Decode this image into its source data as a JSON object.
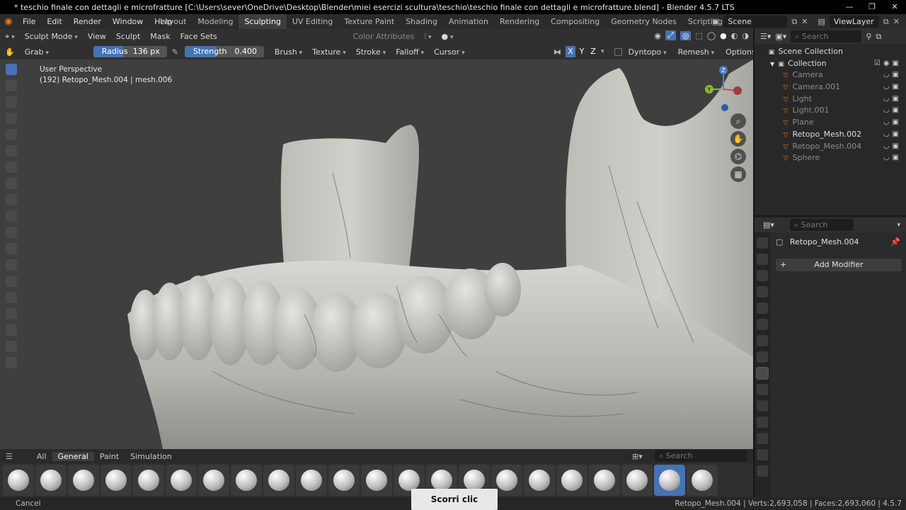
{
  "window": {
    "title": "* teschio finale con dettagli e microfratture [C:\\Users\\sever\\OneDrive\\Desktop\\Blender\\miei esercizi scultura\\teschio\\teschio finale con dettagli e microfratture.blend] - Blender 4.5.7 LTS",
    "minimize": "—",
    "maximize": "❐",
    "close": "✕"
  },
  "menu": {
    "items": [
      "File",
      "Edit",
      "Render",
      "Window",
      "Help"
    ],
    "workspaces": [
      "Layout",
      "Modeling",
      "Sculpting",
      "UV Editing",
      "Texture Paint",
      "Shading",
      "Animation",
      "Rendering",
      "Compositing",
      "Geometry Nodes",
      "Scripting"
    ],
    "active_workspace": "Sculpting",
    "add_workspace": "+",
    "scene": "Scene",
    "view_layer": "ViewLayer"
  },
  "header1": {
    "mode": "Sculpt Mode",
    "items": [
      "View",
      "Sculpt",
      "Mask",
      "Face Sets"
    ],
    "color_attributes": "Color Attributes"
  },
  "header2": {
    "brush": "Grab",
    "radius_label": "Radius",
    "radius_value": "136 px",
    "strength_label": "Strength",
    "strength_value": "0.400",
    "strength_fraction": 0.4,
    "menus": [
      "Brush",
      "Texture",
      "Stroke",
      "Falloff",
      "Cursor"
    ],
    "axes": [
      "X",
      "Y",
      "Z"
    ],
    "right_menus": [
      "Dyntopo",
      "Remesh",
      "Options"
    ]
  },
  "viewport": {
    "perspective": "User Perspective",
    "object_info": "(192) Retopo_Mesh.004 | mesh.006",
    "gizmo": {
      "y": "Y",
      "z": "Z"
    }
  },
  "shelf": {
    "tabs": [
      "All",
      "General",
      "Paint",
      "Simulation"
    ],
    "active_tab": "General",
    "search_placeholder": "Search",
    "brush_count": 22
  },
  "status": {
    "left": "Cancel",
    "right": "Retopo_Mesh.004 | Verts:2,693,058 | Faces:2,693,060 | 4.5.7"
  },
  "caption": "Scorri clic",
  "outliner": {
    "search_placeholder": "Search",
    "root": "Scene Collection",
    "collection": "Collection",
    "items": [
      {
        "name": "Camera",
        "dim": true
      },
      {
        "name": "Camera.001",
        "dim": true
      },
      {
        "name": "Light",
        "dim": true
      },
      {
        "name": "Light.001",
        "dim": true
      },
      {
        "name": "Plane",
        "dim": true
      },
      {
        "name": "Retopo_Mesh.002",
        "dim": false
      },
      {
        "name": "Retopo_Mesh.004",
        "dim": true
      },
      {
        "name": "Sphere",
        "dim": true
      }
    ]
  },
  "properties": {
    "search_placeholder": "Search",
    "object": "Retopo_Mesh.004",
    "add_modifier": "Add Modifier"
  }
}
